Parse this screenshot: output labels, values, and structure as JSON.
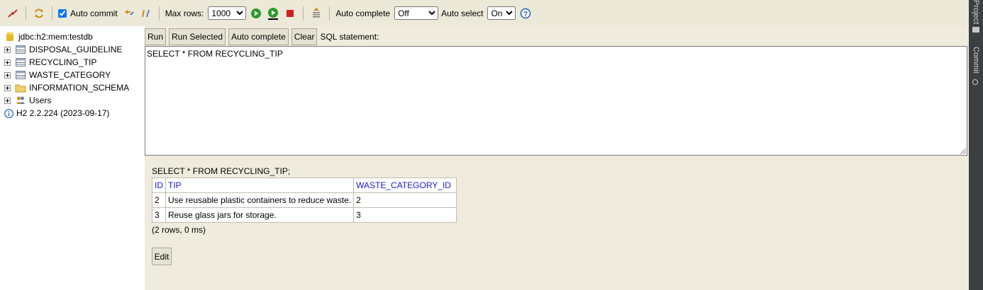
{
  "toolbar": {
    "auto_commit_label": "Auto commit",
    "max_rows_label": "Max rows:",
    "max_rows_value": "1000",
    "auto_complete_label": "Auto complete",
    "auto_complete_value": "Off",
    "auto_select_label": "Auto select",
    "auto_select_value": "On"
  },
  "side_strip": {
    "project_label": "Project",
    "commit_label": "Commit"
  },
  "tree": {
    "connection": "jdbc:h2:mem:testdb",
    "tables": [
      "DISPOSAL_GUIDELINE",
      "RECYCLING_TIP",
      "WASTE_CATEGORY"
    ],
    "schema": "INFORMATION_SCHEMA",
    "users": "Users",
    "version": "H2 2.2.224 (2023-09-17)"
  },
  "buttons": {
    "run": "Run",
    "run_selected": "Run Selected",
    "auto_complete": "Auto complete",
    "clear": "Clear",
    "sql_statement_label": "SQL statement:"
  },
  "sql_text": "SELECT * FROM RECYCLING_TIP",
  "result": {
    "statement": "SELECT * FROM RECYCLING_TIP;",
    "columns": [
      "ID",
      "TIP",
      "WASTE_CATEGORY_ID"
    ],
    "rows": [
      [
        "2",
        "Use reusable plastic containers to reduce waste.",
        "2"
      ],
      [
        "3",
        "Reuse glass jars for storage.",
        "3"
      ]
    ],
    "summary": "(2 rows, 0 ms)",
    "edit_label": "Edit"
  }
}
